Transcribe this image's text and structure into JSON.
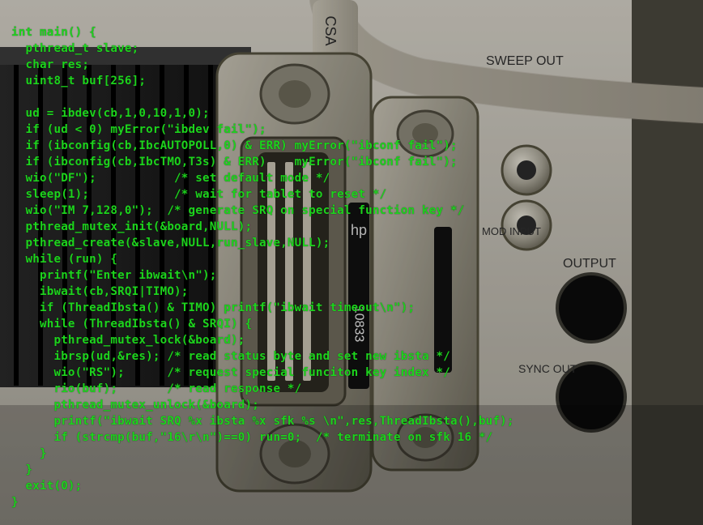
{
  "code": {
    "lines": [
      "int main() {",
      "  pthread_t slave;",
      "  char res;",
      "  uint8_t buf[256];",
      "",
      "  ud = ibdev(cb,1,0,10,1,0);",
      "  if (ud < 0) myError(\"ibdev fail\");",
      "  if (ibconfig(cb,IbcAUTOPOLL,0) & ERR) myError(\"ibconf fail\");",
      "  if (ibconfig(cb,IbcTMO,T3s) & ERR)    myError(\"ibconf fail\");",
      "  wio(\"DF\");           /* set default mode */",
      "  sleep(1);            /* wait for tablet to reset */",
      "  wio(\"IM 7,128,0\");  /* generate SRQ on special function key */",
      "  pthread_mutex_init(&board,NULL);",
      "  pthread_create(&slave,NULL,run_slave,NULL);",
      "  while (run) {",
      "    printf(\"Enter ibwait\\n\");",
      "    ibwait(cb,SRQI|TIMO);",
      "    if (ThreadIbsta() & TIMO) printf(\"ibwait timeout\\n\");",
      "    while (ThreadIbsta() & SRQI) {",
      "      pthread_mutex_lock(&board);",
      "      ibrsp(ud,&res); /* read status byte and set new ibsta */",
      "      wio(\"RS\");      /* request special funciton key index */",
      "      rio(buf);       /* read response */",
      "      pthread_mutex_unlock(&board);",
      "      printf(\"ibwait SRQ %x ibsta %x sfk %s \\n\",res,ThreadIbsta(),buf);",
      "      if (strcmp(buf,\"16\\r\\n\")==0) run=0;  /* terminate on sfk 16 */",
      "    }",
      "  }",
      "  exit(0);",
      "}"
    ]
  },
  "equipment": {
    "panel_labels": [
      "SWEEP OUT",
      "MOD INPUT",
      "OUTPUT",
      "SYNC OUT"
    ],
    "connector_part_numbers": [
      "10833"
    ],
    "cable_marking": "CSA"
  }
}
